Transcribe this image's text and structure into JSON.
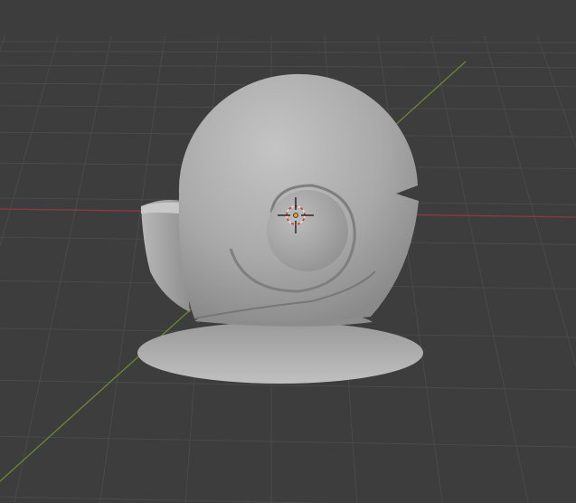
{
  "viewport": {
    "background": "#3d3d3d",
    "grid_color": "#4a4a4a",
    "x_axis_color": "#8a3a43",
    "y_axis_color": "#6a8a2e",
    "object_color": "#a8a8a8"
  },
  "icons": {
    "cursor": "3d-cursor-icon",
    "origin": "object-origin-icon"
  }
}
